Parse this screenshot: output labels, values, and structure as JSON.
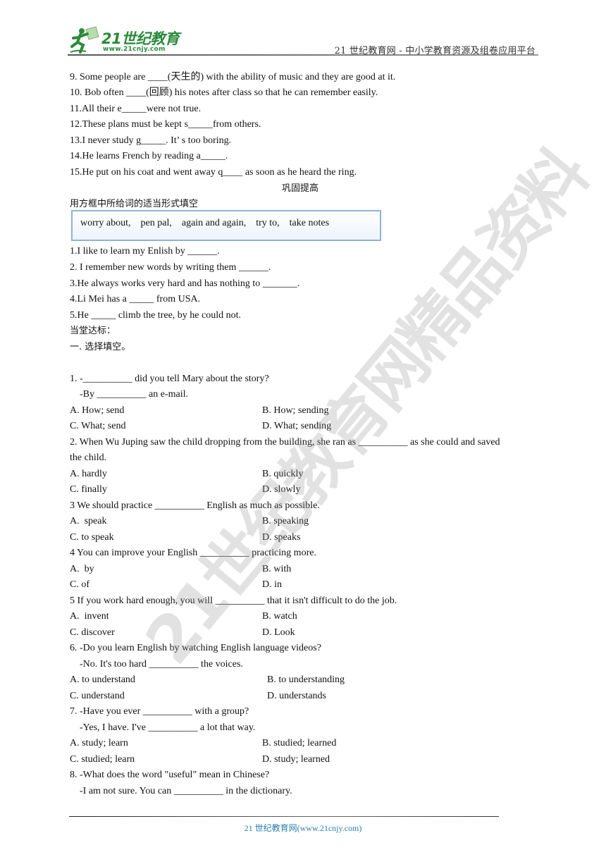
{
  "header": {
    "logo_title": "21世纪教育",
    "logo_url": "www.21cnjy.com",
    "tagline": "21 世纪教育网  - 中小学教育资源及组卷应用平台"
  },
  "section_a": {
    "items": [
      "9. Some people are ____(天生的) with the ability of music and they are good at it.",
      "10. Bob often ____(回顾) his notes after class so that he can remember easily.",
      "11.All their e_____were not true.",
      "12.These plans must be kept s_____from others.",
      "13.I never study g_____. It’ s too boring.",
      "14.He learns French by reading a_____.",
      "15.He put on his coat and went away q____ as soon as he heard the ring."
    ]
  },
  "section_b": {
    "heading": "巩固提高",
    "instruction": "用方框中所给词的适当形式填空",
    "word_box": "worry about,    pen pal,    again and again,    try to,    take notes",
    "items": [
      "1.I like to learn my Enlish by ______.",
      "2. I remember new words by writing them ______.",
      "3.He always works very hard and has nothing to _______.",
      "4.Li Mei has a _____ from USA.",
      "5.He _____ climb the tree, by he could not."
    ]
  },
  "section_c": {
    "heading": "当堂达标：",
    "subheading": "一. 选择填空。",
    "questions": [
      {
        "lines": [
          "1. -__________ did you tell Mary about the story?",
          "    -By __________ an e-mail."
        ],
        "options": [
          "A. How; send",
          "B. How; sending",
          "C. What; send",
          "D. What; sending"
        ]
      },
      {
        "lines": [
          "2. When Wu Juping saw the child dropping from the building, she ran as __________ as she could and saved",
          "the child."
        ],
        "options": [
          "A. hardly",
          "B. quickly",
          "C. finally",
          "D. slowly"
        ]
      },
      {
        "lines": [
          "3 We should practice __________ English as much as possible."
        ],
        "options": [
          "A.  speak",
          "B. speaking",
          "C. to speak",
          "D. speaks"
        ]
      },
      {
        "lines": [
          "4 You can improve your English __________ practicing more."
        ],
        "options": [
          "A.  by",
          "B. with",
          "C. of",
          "D. in"
        ]
      },
      {
        "lines": [
          "5 If you work hard enough, you will __________ that it isn't difficult to do the job."
        ],
        "options": [
          "A.  invent",
          "B. watch",
          "C. discover",
          "D. Look"
        ]
      },
      {
        "lines": [
          "6. -Do you learn English by watching English language videos?",
          "    -No. It's too hard __________ the voices."
        ],
        "options": [
          "A. to understand",
          "B. to understanding",
          "C. understand",
          "D. understands"
        ]
      },
      {
        "lines": [
          "7. -Have you ever __________ with a group?",
          "    -Yes, I have. I've __________ a lot that way."
        ],
        "options": [
          "A. study; learn",
          "B. studied; learned",
          "C. studied; learn",
          "D. study; learned"
        ]
      },
      {
        "lines": [
          "8. -What does the word \"useful\" mean in Chinese?",
          "    -I am not sure. You can __________ in the dictionary."
        ],
        "options": []
      }
    ]
  },
  "footer": {
    "text": "21 世纪教育网(www.21cnjy.com)"
  },
  "watermark": {
    "text": "21世纪教育网精品资料"
  },
  "colors": {
    "brand_green": "#2a8a3a",
    "footer_blue": "#2a7fb0",
    "box_border": "#8fb3d9"
  }
}
